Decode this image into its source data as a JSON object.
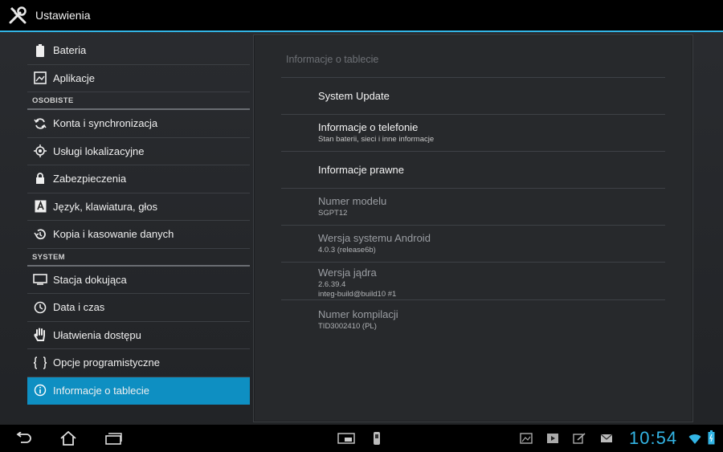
{
  "actionbar": {
    "title": "Ustawienia",
    "icon": "tools-icon"
  },
  "left_list": {
    "items_top": [
      {
        "label": "Bateria",
        "icon": "battery-icon"
      },
      {
        "label": "Aplikacje",
        "icon": "apps-icon"
      }
    ],
    "section_personal": "OSOBISTE",
    "items_personal": [
      {
        "label": "Konta i synchronizacja",
        "icon": "sync-icon"
      },
      {
        "label": "Usługi lokalizacyjne",
        "icon": "location-icon"
      },
      {
        "label": "Zabezpieczenia",
        "icon": "lock-icon"
      },
      {
        "label": "Język, klawiatura, głos",
        "icon": "language-icon"
      },
      {
        "label": "Kopia i kasowanie danych",
        "icon": "backup-icon"
      }
    ],
    "section_system": "SYSTEM",
    "items_system": [
      {
        "label": "Stacja dokująca",
        "icon": "dock-icon"
      },
      {
        "label": "Data i czas",
        "icon": "clock-icon"
      },
      {
        "label": "Ułatwienia dostępu",
        "icon": "hand-icon"
      },
      {
        "label": "Opcje programistyczne",
        "icon": "braces-icon"
      },
      {
        "label": "Informacje o tablecie",
        "icon": "info-icon",
        "selected": true
      }
    ]
  },
  "detail": {
    "title": "Informacje o tablecie",
    "prefs": [
      {
        "title": "System Update",
        "summary": ""
      },
      {
        "title": "Informacje o telefonie",
        "summary": "Stan baterii, sieci i inne informacje"
      },
      {
        "title": "Informacje prawne",
        "summary": ""
      },
      {
        "title": "Numer modelu",
        "summary": "SGPT12"
      },
      {
        "title": "Wersja systemu Android",
        "summary": "4.0.3  (release6b)"
      },
      {
        "title": "Wersja jądra",
        "summary": "2.6.39.4",
        "summary2": "integ-build@build10 #1"
      },
      {
        "title": "Numer kompilacji",
        "summary": "TID3002410 (PL)"
      }
    ]
  },
  "sysbar": {
    "clock": "10:54",
    "nav": [
      "back-icon",
      "home-icon",
      "recents-icon"
    ],
    "colors": {
      "accent": "#33b5e5",
      "selected": "#0e8fc2"
    }
  }
}
